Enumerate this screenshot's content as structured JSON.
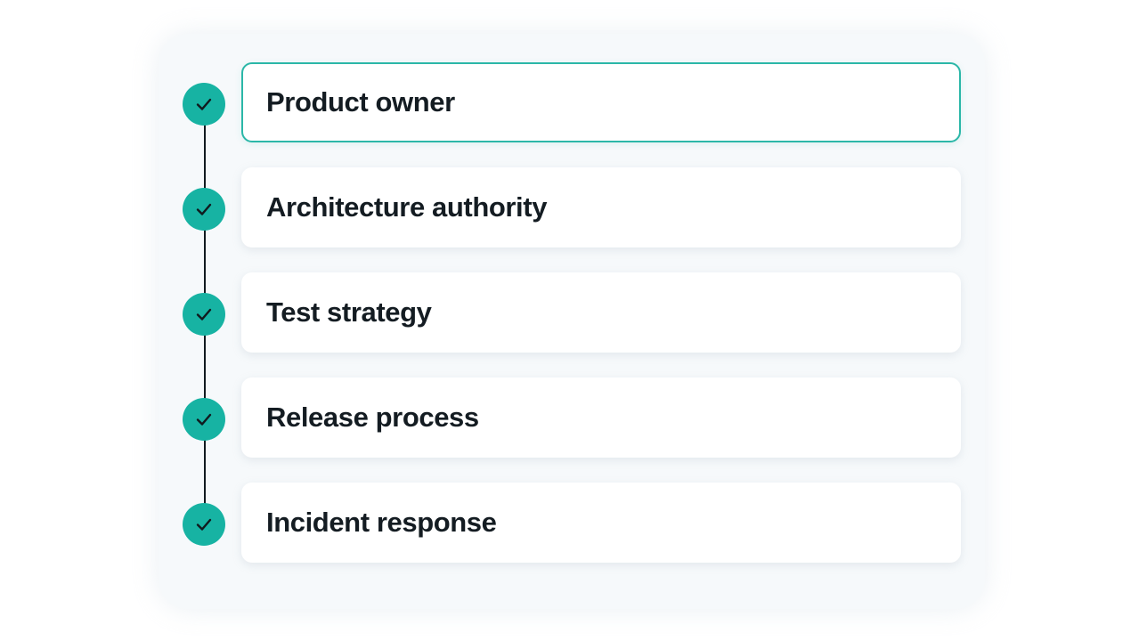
{
  "steps": [
    {
      "label": "Product owner",
      "status": "complete",
      "active": true
    },
    {
      "label": "Architecture authority",
      "status": "complete",
      "active": false
    },
    {
      "label": "Test strategy",
      "status": "complete",
      "active": false
    },
    {
      "label": "Release process",
      "status": "complete",
      "active": false
    },
    {
      "label": "Incident response",
      "status": "complete",
      "active": false
    }
  ],
  "colors": {
    "accent": "#17b3a3",
    "active_border": "#2bb7a8",
    "text": "#141c22",
    "connector": "#111a1f"
  },
  "icons": {
    "marker": "checkmark-icon"
  }
}
